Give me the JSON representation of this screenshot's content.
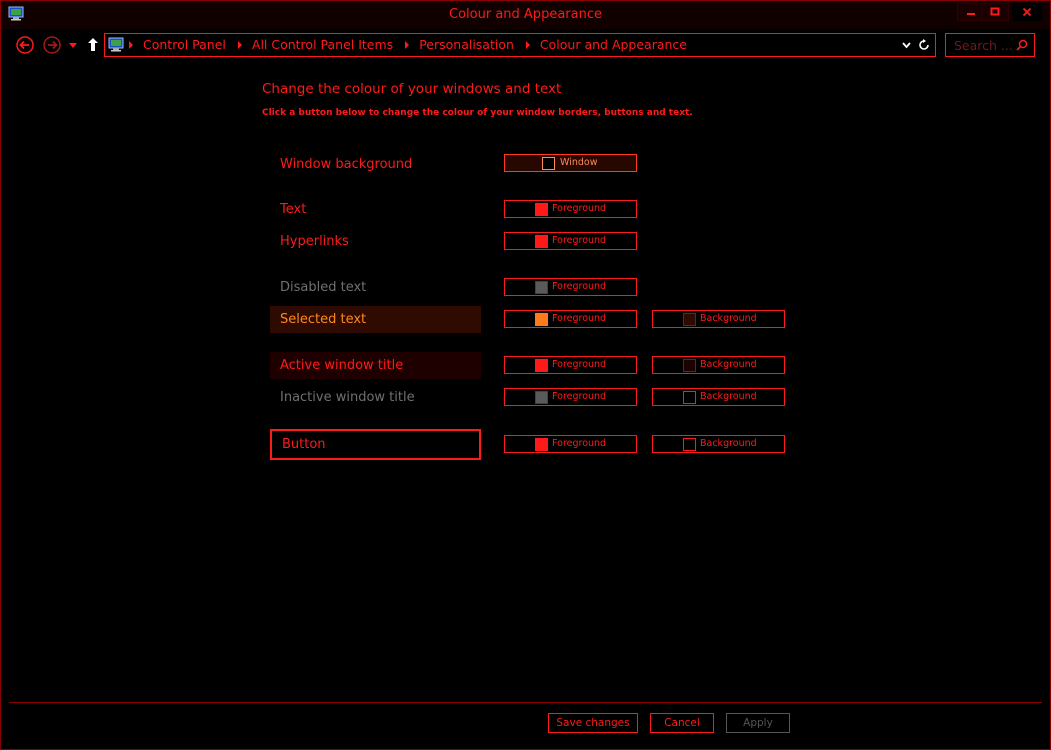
{
  "window": {
    "title": "Colour and Appearance"
  },
  "address": {
    "crumbs": [
      "Control Panel",
      "All Control Panel Items",
      "Personalisation",
      "Colour and Appearance"
    ]
  },
  "search": {
    "placeholder": "Search ..."
  },
  "page": {
    "heading": "Change the colour of your windows and text",
    "subheading": "Click a button below to change the colour of your window borders, buttons and text."
  },
  "rows": {
    "window_background": {
      "label": "Window background",
      "button": {
        "label": "Window",
        "color": "#000000"
      }
    },
    "text": {
      "label": "Text",
      "foreground": {
        "label": "Foreground",
        "color": "#ff1a1a"
      }
    },
    "hyperlinks": {
      "label": "Hyperlinks",
      "foreground": {
        "label": "Foreground",
        "color": "#ff1a1a"
      }
    },
    "disabled_text": {
      "label": "Disabled text",
      "foreground": {
        "label": "Foreground",
        "color": "#5a5a5a"
      }
    },
    "selected_text": {
      "label": "Selected text",
      "foreground": {
        "label": "Foreground",
        "color": "#ff7a1a"
      },
      "background": {
        "label": "Background",
        "color": "#2e0a00"
      }
    },
    "active_window_title": {
      "label": "Active window title",
      "foreground": {
        "label": "Foreground",
        "color": "#ff1a1a"
      },
      "background": {
        "label": "Background",
        "color": "#1e0000"
      }
    },
    "inactive_window_title": {
      "label": "Inactive window title",
      "foreground": {
        "label": "Foreground",
        "color": "#5a5a5a"
      },
      "background": {
        "label": "Background",
        "color": "#000000"
      }
    },
    "button": {
      "label": "Button",
      "foreground": {
        "label": "Foreground",
        "color": "#ff1a1a"
      },
      "background": {
        "label": "Background",
        "color": "#000000"
      }
    }
  },
  "footer": {
    "save_label": "Save changes",
    "cancel_label": "Cancel",
    "apply_label": "Apply"
  },
  "theme": {
    "accent": "#ff1a1a",
    "background": "#000000",
    "disabled": "#707070"
  }
}
